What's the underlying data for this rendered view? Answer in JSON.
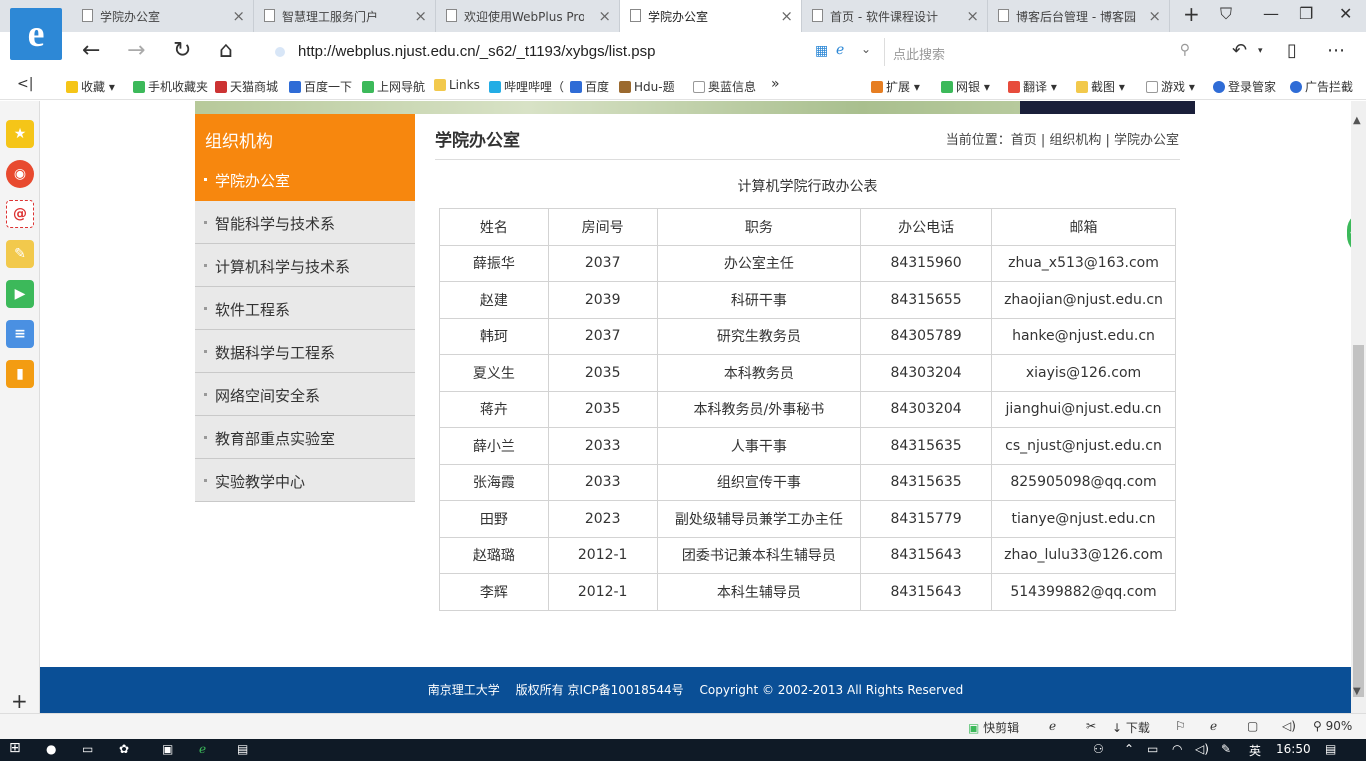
{
  "browser": {
    "logo_letter": "e",
    "tabs": [
      {
        "label": "学院办公室"
      },
      {
        "label": "智慧理工服务门户"
      },
      {
        "label": "欢迎使用WebPlus Pro"
      },
      {
        "label": "学院办公室"
      },
      {
        "label": "首页 - 软件课程设计"
      },
      {
        "label": "博客后台管理 - 博客园"
      }
    ],
    "active_tab_index": 3,
    "new_tab": "+",
    "url": "http://webplus.njust.edu.cn/_s62/_t1193/xybgs/list.psp",
    "search_placeholder": "点此搜索",
    "bookmarks": [
      "收藏",
      "手机收藏夹",
      "天猫商城",
      "百度一下",
      "上网导航",
      "Links",
      "哔哩哔哩（",
      "百度",
      "Hdu-题",
      "奥蓝信息"
    ],
    "more_bookmarks": "»",
    "toolbar_right": [
      "扩展",
      "网银",
      "翻译",
      "截图",
      "游戏",
      "登录管家",
      "广告拦截"
    ]
  },
  "page": {
    "sidebar_title": "组织机构",
    "sidebar_items": [
      {
        "label": "学院办公室"
      },
      {
        "label": "智能科学与技术系"
      },
      {
        "label": "计算机科学与技术系"
      },
      {
        "label": "软件工程系"
      },
      {
        "label": "数据科学与工程系"
      },
      {
        "label": "网络空间安全系"
      },
      {
        "label": "教育部重点实验室"
      },
      {
        "label": "实验教学中心"
      }
    ],
    "active_sidebar_index": 0,
    "title": "学院办公室",
    "breadcrumb": "当前位置：首页 | 组织机构 | 学院办公室",
    "table_caption": "计算机学院行政办公表",
    "table_headers": [
      "姓名",
      "房间号",
      "职务",
      "办公电话",
      "邮箱"
    ],
    "table_rows": [
      [
        "薛振华",
        "2037",
        "办公室主任",
        "84315960",
        "zhua_x513@163.com"
      ],
      [
        "赵建",
        "2039",
        "科研干事",
        "84315655",
        "zhaojian@njust.edu.cn"
      ],
      [
        "韩珂",
        "2037",
        "研究生教务员",
        "84305789",
        "hanke@njust.edu.cn"
      ],
      [
        "夏义生",
        "2035",
        "本科教务员",
        "84303204",
        "xiayis@126.com"
      ],
      [
        "蒋卉",
        "2035",
        "本科教务员/外事秘书",
        "84303204",
        "jianghui@njust.edu.cn"
      ],
      [
        "薛小兰",
        "2033",
        "人事干事",
        "84315635",
        "cs_njust@njust.edu.cn"
      ],
      [
        "张海霞",
        "2033",
        "组织宣传干事",
        "84315635",
        "825905098@qq.com"
      ],
      [
        "田野",
        "2023",
        "副处级辅导员兼学工办主任",
        "84315779",
        "tianye@njust.edu.cn"
      ],
      [
        "赵璐璐",
        "2012-1",
        "团委书记兼本科生辅导员",
        "84315643",
        "zhao_lulu33@126.com"
      ],
      [
        "李辉",
        "2012-1",
        "本科生辅导员",
        "84315643",
        "514399882@qq.com"
      ]
    ],
    "footer": {
      "school": "南京理工大学",
      "rights": "版权所有 京ICP备10018544号",
      "copyright": "Copyright © 2002-2013 All Rights Reserved"
    }
  },
  "statusbar": {
    "quick_edit": "快剪辑",
    "download": "下载",
    "zoom": "90%"
  },
  "taskbar": {
    "ime": "英",
    "time": "16:50"
  },
  "colors": {
    "accent": "#f7870e",
    "footer": "#0a4f96"
  }
}
